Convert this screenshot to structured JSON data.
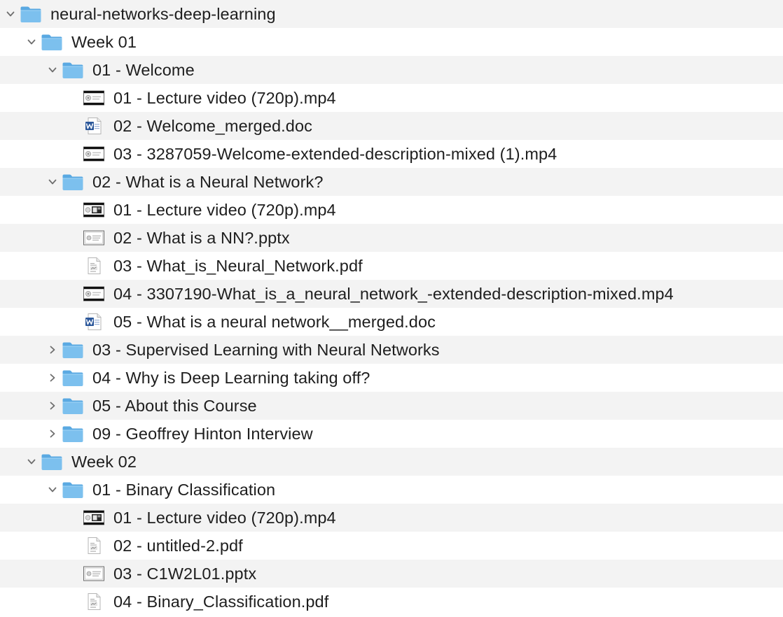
{
  "tree": [
    {
      "label": "neural-networks-deep-learning",
      "depth": 0,
      "kind": "folder",
      "expanded": true,
      "icon": "folder-icon"
    },
    {
      "label": "Week 01",
      "depth": 1,
      "kind": "folder",
      "expanded": true,
      "icon": "folder-icon"
    },
    {
      "label": "01 - Welcome",
      "depth": 2,
      "kind": "folder",
      "expanded": true,
      "icon": "folder-icon"
    },
    {
      "label": "01 - Lecture video (720p).mp4",
      "depth": 3,
      "kind": "file",
      "icon": "video-file-icon"
    },
    {
      "label": "02 - Welcome_merged.doc",
      "depth": 3,
      "kind": "file",
      "icon": "word-doc-icon"
    },
    {
      "label": "03 - 3287059-Welcome-extended-description-mixed (1).mp4",
      "depth": 3,
      "kind": "file",
      "icon": "video-file-icon"
    },
    {
      "label": "02 - What is a Neural Network?",
      "depth": 2,
      "kind": "folder",
      "expanded": true,
      "icon": "folder-icon"
    },
    {
      "label": "01 - Lecture video (720p).mp4",
      "depth": 3,
      "kind": "file",
      "icon": "video-thumb-icon"
    },
    {
      "label": "02 - What is a NN?.pptx",
      "depth": 3,
      "kind": "file",
      "icon": "presentation-file-icon"
    },
    {
      "label": "03 - What_is_Neural_Network.pdf",
      "depth": 3,
      "kind": "file",
      "icon": "pdf-file-icon"
    },
    {
      "label": "04 - 3307190-What_is_a_neural_network_-extended-description-mixed.mp4",
      "depth": 3,
      "kind": "file",
      "icon": "video-file-icon"
    },
    {
      "label": "05 - What is a neural network__merged.doc",
      "depth": 3,
      "kind": "file",
      "icon": "word-doc-icon"
    },
    {
      "label": "03 - Supervised Learning with Neural Networks",
      "depth": 2,
      "kind": "folder",
      "expanded": false,
      "icon": "folder-icon"
    },
    {
      "label": "04 - Why is Deep Learning taking off?",
      "depth": 2,
      "kind": "folder",
      "expanded": false,
      "icon": "folder-icon"
    },
    {
      "label": "05 - About this Course",
      "depth": 2,
      "kind": "folder",
      "expanded": false,
      "icon": "folder-icon"
    },
    {
      "label": "09 - Geoffrey Hinton Interview",
      "depth": 2,
      "kind": "folder",
      "expanded": false,
      "icon": "folder-icon"
    },
    {
      "label": "Week 02",
      "depth": 1,
      "kind": "folder",
      "expanded": true,
      "icon": "folder-icon"
    },
    {
      "label": "01 - Binary Classification",
      "depth": 2,
      "kind": "folder",
      "expanded": true,
      "icon": "folder-icon"
    },
    {
      "label": "01 - Lecture video (720p).mp4",
      "depth": 3,
      "kind": "file",
      "icon": "video-thumb-icon"
    },
    {
      "label": "02 - untitled-2.pdf",
      "depth": 3,
      "kind": "file",
      "icon": "pdf-file-icon"
    },
    {
      "label": "03 - C1W2L01.pptx",
      "depth": 3,
      "kind": "file",
      "icon": "presentation-file-icon"
    },
    {
      "label": "04 - Binary_Classification.pdf",
      "depth": 3,
      "kind": "file",
      "icon": "pdf-file-icon"
    }
  ],
  "colors": {
    "row_alt": "#f3f3f3",
    "folder_body": "#7cc0ee",
    "folder_tab": "#5aa9e2",
    "word_blue": "#2b579a",
    "text": "#1e1e1e",
    "chevron": "#6e6e6e"
  }
}
